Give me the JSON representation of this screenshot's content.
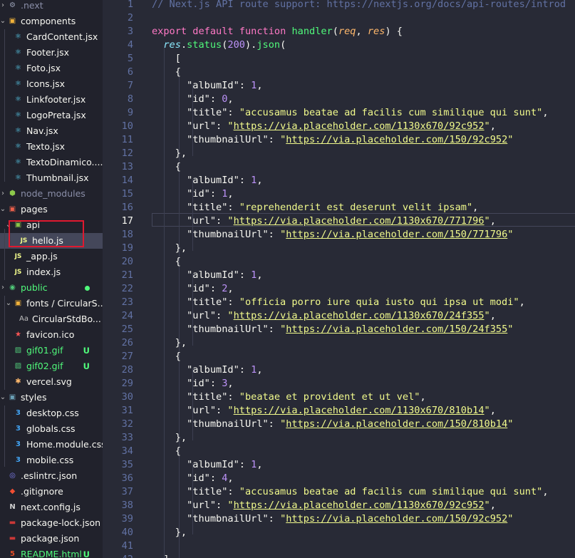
{
  "explorer": {
    "items": [
      {
        "label": ".next",
        "icon": "settings-folder-icon",
        "glyph": "⚙",
        "color": "#9aa0b5",
        "depth": 0,
        "kind": "folder",
        "open": false,
        "dim": true
      },
      {
        "label": "components",
        "icon": "folder-icon",
        "glyph": "▣",
        "color": "#f0b13a",
        "depth": 0,
        "kind": "folder",
        "open": true
      },
      {
        "label": "CardContent.jsx",
        "icon": "react-icon",
        "glyph": "⚛",
        "color": "#5ad4f5",
        "depth": 1,
        "kind": "file"
      },
      {
        "label": "Footer.jsx",
        "icon": "react-icon",
        "glyph": "⚛",
        "color": "#5ad4f5",
        "depth": 1,
        "kind": "file"
      },
      {
        "label": "Foto.jsx",
        "icon": "react-icon",
        "glyph": "⚛",
        "color": "#5ad4f5",
        "depth": 1,
        "kind": "file"
      },
      {
        "label": "Icons.jsx",
        "icon": "react-icon",
        "glyph": "⚛",
        "color": "#5ad4f5",
        "depth": 1,
        "kind": "file"
      },
      {
        "label": "Linkfooter.jsx",
        "icon": "react-icon",
        "glyph": "⚛",
        "color": "#5ad4f5",
        "depth": 1,
        "kind": "file"
      },
      {
        "label": "LogoPreta.jsx",
        "icon": "react-icon",
        "glyph": "⚛",
        "color": "#5ad4f5",
        "depth": 1,
        "kind": "file"
      },
      {
        "label": "Nav.jsx",
        "icon": "react-icon",
        "glyph": "⚛",
        "color": "#5ad4f5",
        "depth": 1,
        "kind": "file"
      },
      {
        "label": "Texto.jsx",
        "icon": "react-icon",
        "glyph": "⚛",
        "color": "#5ad4f5",
        "depth": 1,
        "kind": "file"
      },
      {
        "label": "TextoDinamico....",
        "icon": "react-icon",
        "glyph": "⚛",
        "color": "#5ad4f5",
        "depth": 1,
        "kind": "file"
      },
      {
        "label": "Thumbnail.jsx",
        "icon": "react-icon",
        "glyph": "⚛",
        "color": "#5ad4f5",
        "depth": 1,
        "kind": "file"
      },
      {
        "label": "node_modules",
        "icon": "node-folder-icon",
        "glyph": "⬢",
        "color": "#8cc84b",
        "depth": 0,
        "kind": "folder",
        "open": false,
        "dim": true
      },
      {
        "label": "pages",
        "icon": "folder-icon",
        "glyph": "▣",
        "color": "#e95f4a",
        "depth": 0,
        "kind": "folder",
        "open": true
      },
      {
        "label": "api",
        "icon": "api-folder-icon",
        "glyph": "▣",
        "color": "#8bc34a",
        "depth": 1,
        "kind": "folder",
        "open": true
      },
      {
        "label": "hello.js",
        "icon": "javascript-icon",
        "glyph": "JS",
        "color": "#f1fa8c",
        "depth": 2,
        "kind": "file",
        "selected": true
      },
      {
        "label": "_app.js",
        "icon": "javascript-icon",
        "glyph": "JS",
        "color": "#f1fa8c",
        "depth": 1,
        "kind": "file"
      },
      {
        "label": "index.js",
        "icon": "javascript-icon",
        "glyph": "JS",
        "color": "#f1fa8c",
        "depth": 1,
        "kind": "file"
      },
      {
        "label": "public",
        "icon": "public-folder-icon",
        "glyph": "◉",
        "color": "#50c878",
        "depth": 0,
        "kind": "folder",
        "open": false,
        "green": true,
        "dot": true
      },
      {
        "label": "fonts / CircularS...",
        "icon": "folder-icon",
        "glyph": "▣",
        "color": "#f0b13a",
        "depth": 1,
        "kind": "folder",
        "open": true
      },
      {
        "label": "CircularStdBo...",
        "icon": "font-icon",
        "glyph": "Aa",
        "color": "#bfbfbf",
        "depth": 2,
        "kind": "file"
      },
      {
        "label": "favicon.ico",
        "icon": "favicon-icon",
        "glyph": "★",
        "color": "#ff5555",
        "depth": 1,
        "kind": "file"
      },
      {
        "label": "gif01.gif",
        "icon": "image-icon",
        "glyph": "▨",
        "color": "#50c878",
        "depth": 1,
        "kind": "file",
        "green": true,
        "badge": "U"
      },
      {
        "label": "gif02.gif",
        "icon": "image-icon",
        "glyph": "▨",
        "color": "#50c878",
        "depth": 1,
        "kind": "file",
        "green": true,
        "badge": "U"
      },
      {
        "label": "vercel.svg",
        "icon": "svg-icon",
        "glyph": "✱",
        "color": "#ffb86c",
        "depth": 1,
        "kind": "file"
      },
      {
        "label": "styles",
        "icon": "folder-icon",
        "glyph": "▣",
        "color": "#6a9fb5",
        "depth": 0,
        "kind": "folder",
        "open": true
      },
      {
        "label": "desktop.css",
        "icon": "css-icon",
        "glyph": "3",
        "color": "#42a5f5",
        "depth": 1,
        "kind": "file"
      },
      {
        "label": "globals.css",
        "icon": "css-icon",
        "glyph": "3",
        "color": "#42a5f5",
        "depth": 1,
        "kind": "file"
      },
      {
        "label": "Home.module.css",
        "icon": "css-icon",
        "glyph": "3",
        "color": "#42a5f5",
        "depth": 1,
        "kind": "file"
      },
      {
        "label": "mobile.css",
        "icon": "css-icon",
        "glyph": "3",
        "color": "#42a5f5",
        "depth": 1,
        "kind": "file"
      },
      {
        "label": ".eslintrc.json",
        "icon": "eslint-icon",
        "glyph": "◎",
        "color": "#8080f2",
        "depth": 0,
        "kind": "file"
      },
      {
        "label": ".gitignore",
        "icon": "git-icon",
        "glyph": "◆",
        "color": "#f14e32",
        "depth": 0,
        "kind": "file"
      },
      {
        "label": "next.config.js",
        "icon": "next-icon",
        "glyph": "N",
        "color": "#d0d0d0",
        "depth": 0,
        "kind": "file"
      },
      {
        "label": "package-lock.json",
        "icon": "npm-icon",
        "glyph": "▬",
        "color": "#cb3837",
        "depth": 0,
        "kind": "file"
      },
      {
        "label": "package.json",
        "icon": "npm-icon",
        "glyph": "▬",
        "color": "#cb3837",
        "depth": 0,
        "kind": "file"
      },
      {
        "label": "README.html",
        "icon": "html-icon",
        "glyph": "5",
        "color": "#e44d26",
        "depth": 0,
        "kind": "file",
        "green": true,
        "badge": "U"
      }
    ]
  },
  "editor": {
    "current_line": 17,
    "lines": [
      [
        [
          "c",
          "// Next.js API route support: "
        ],
        [
          "c",
          "https://nextjs.org/docs/api-routes/introd"
        ]
      ],
      [],
      [
        [
          "k",
          "export "
        ],
        [
          "k",
          "default "
        ],
        [
          "k",
          "function "
        ],
        [
          "f",
          "handler"
        ],
        [
          "w",
          "("
        ],
        [
          "p",
          "req"
        ],
        [
          "w",
          ", "
        ],
        [
          "p",
          "res"
        ],
        [
          "w",
          ") {"
        ]
      ],
      [
        [
          "w",
          "  "
        ],
        [
          "v",
          "res"
        ],
        [
          "w",
          "."
        ],
        [
          "f",
          "status"
        ],
        [
          "w",
          "("
        ],
        [
          "n",
          "200"
        ],
        [
          "w",
          ")."
        ],
        [
          "f",
          "json"
        ],
        [
          "w",
          "("
        ]
      ],
      [
        [
          "w",
          "    ["
        ]
      ],
      [
        [
          "w",
          "    {"
        ]
      ],
      [
        [
          "w",
          "      \"albumId\": "
        ],
        [
          "n",
          "1"
        ],
        [
          "w",
          ","
        ]
      ],
      [
        [
          "w",
          "      \"id\": "
        ],
        [
          "n",
          "0"
        ],
        [
          "w",
          ","
        ]
      ],
      [
        [
          "w",
          "      \"title\": "
        ],
        [
          "s",
          "\"accusamus beatae ad facilis cum similique qui sunt\""
        ],
        [
          "w",
          ","
        ]
      ],
      [
        [
          "w",
          "      \"url\": "
        ],
        [
          "s",
          "\""
        ],
        [
          "u",
          "https://via.placeholder.com/1130x670/92c952"
        ],
        [
          "s",
          "\""
        ],
        [
          "w",
          ","
        ]
      ],
      [
        [
          "w",
          "      \"thumbnailUrl\": "
        ],
        [
          "s",
          "\""
        ],
        [
          "u",
          "https://via.placeholder.com/150/92c952"
        ],
        [
          "s",
          "\""
        ]
      ],
      [
        [
          "w",
          "    },"
        ]
      ],
      [
        [
          "w",
          "    {"
        ]
      ],
      [
        [
          "w",
          "      \"albumId\": "
        ],
        [
          "n",
          "1"
        ],
        [
          "w",
          ","
        ]
      ],
      [
        [
          "w",
          "      \"id\": "
        ],
        [
          "n",
          "1"
        ],
        [
          "w",
          ","
        ]
      ],
      [
        [
          "w",
          "      \"title\": "
        ],
        [
          "s",
          "\"reprehenderit est deserunt velit ipsam\""
        ],
        [
          "w",
          ","
        ]
      ],
      [
        [
          "w",
          "      \"url\": "
        ],
        [
          "s",
          "\""
        ],
        [
          "u",
          "https://via.placeholder.com/1130x670/771796"
        ],
        [
          "s",
          "\""
        ],
        [
          "w",
          ","
        ]
      ],
      [
        [
          "w",
          "      \"thumbnailUrl\": "
        ],
        [
          "s",
          "\""
        ],
        [
          "u",
          "https://via.placeholder.com/150/771796"
        ],
        [
          "s",
          "\""
        ]
      ],
      [
        [
          "w",
          "    },"
        ]
      ],
      [
        [
          "w",
          "    {"
        ]
      ],
      [
        [
          "w",
          "      \"albumId\": "
        ],
        [
          "n",
          "1"
        ],
        [
          "w",
          ","
        ]
      ],
      [
        [
          "w",
          "      \"id\": "
        ],
        [
          "n",
          "2"
        ],
        [
          "w",
          ","
        ]
      ],
      [
        [
          "w",
          "      \"title\": "
        ],
        [
          "s",
          "\"officia porro iure quia iusto qui ipsa ut modi\""
        ],
        [
          "w",
          ","
        ]
      ],
      [
        [
          "w",
          "      \"url\": "
        ],
        [
          "s",
          "\""
        ],
        [
          "u",
          "https://via.placeholder.com/1130x670/24f355"
        ],
        [
          "s",
          "\""
        ],
        [
          "w",
          ","
        ]
      ],
      [
        [
          "w",
          "      \"thumbnailUrl\": "
        ],
        [
          "s",
          "\""
        ],
        [
          "u",
          "https://via.placeholder.com/150/24f355"
        ],
        [
          "s",
          "\""
        ]
      ],
      [
        [
          "w",
          "    },"
        ]
      ],
      [
        [
          "w",
          "    {"
        ]
      ],
      [
        [
          "w",
          "      \"albumId\": "
        ],
        [
          "n",
          "1"
        ],
        [
          "w",
          ","
        ]
      ],
      [
        [
          "w",
          "      \"id\": "
        ],
        [
          "n",
          "3"
        ],
        [
          "w",
          ","
        ]
      ],
      [
        [
          "w",
          "      \"title\": "
        ],
        [
          "s",
          "\"beatae et provident et ut vel\""
        ],
        [
          "w",
          ","
        ]
      ],
      [
        [
          "w",
          "      \"url\": "
        ],
        [
          "s",
          "\""
        ],
        [
          "u",
          "https://via.placeholder.com/1130x670/810b14"
        ],
        [
          "s",
          "\""
        ],
        [
          "w",
          ","
        ]
      ],
      [
        [
          "w",
          "      \"thumbnailUrl\": "
        ],
        [
          "s",
          "\""
        ],
        [
          "u",
          "https://via.placeholder.com/150/810b14"
        ],
        [
          "s",
          "\""
        ]
      ],
      [
        [
          "w",
          "    },"
        ]
      ],
      [
        [
          "w",
          "    {"
        ]
      ],
      [
        [
          "w",
          "      \"albumId\": "
        ],
        [
          "n",
          "1"
        ],
        [
          "w",
          ","
        ]
      ],
      [
        [
          "w",
          "      \"id\": "
        ],
        [
          "n",
          "4"
        ],
        [
          "w",
          ","
        ]
      ],
      [
        [
          "w",
          "      \"title\": "
        ],
        [
          "s",
          "\"accusamus beatae ad facilis cum similique qui sunt\""
        ],
        [
          "w",
          ","
        ]
      ],
      [
        [
          "w",
          "      \"url\": "
        ],
        [
          "s",
          "\""
        ],
        [
          "u",
          "https://via.placeholder.com/1130x670/92c952"
        ],
        [
          "s",
          "\""
        ],
        [
          "w",
          ","
        ]
      ],
      [
        [
          "w",
          "      \"thumbnailUrl\": "
        ],
        [
          "s",
          "\""
        ],
        [
          "u",
          "https://via.placeholder.com/150/92c952"
        ],
        [
          "s",
          "\""
        ]
      ],
      [
        [
          "w",
          "    },"
        ]
      ],
      [],
      [
        [
          "w",
          "  ]"
        ]
      ]
    ]
  }
}
